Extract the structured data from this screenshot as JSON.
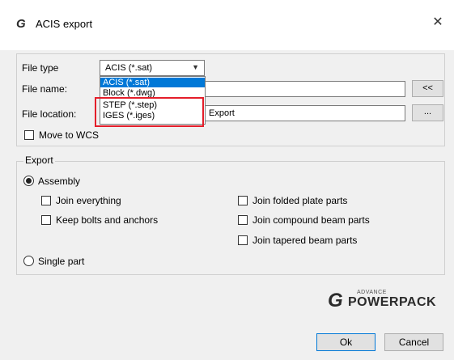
{
  "window": {
    "title": "ACIS export",
    "logo_glyph": "G",
    "close_glyph": "✕"
  },
  "file_type": {
    "label": "File type",
    "selected": "ACIS (*.sat)",
    "options": [
      "ACIS (*.sat)",
      "Block (*.dwg)",
      "STEP (*.step)",
      "IGES (*.iges)"
    ]
  },
  "file_name": {
    "label": "File name:",
    "value": "",
    "button": "<<"
  },
  "file_location": {
    "label": "File location:",
    "value": "Export",
    "button": "..."
  },
  "move_to_wcs": {
    "label": "Move to WCS",
    "checked": false
  },
  "export": {
    "group_label": "Export",
    "assembly": {
      "label": "Assembly",
      "selected": true
    },
    "options_left": [
      "Join everything",
      "Keep bolts and anchors"
    ],
    "options_right": [
      "Join folded plate parts",
      "Join compound beam parts",
      "Join tapered beam parts"
    ],
    "single_part": {
      "label": "Single part",
      "selected": false
    }
  },
  "brand": {
    "glyph": "G",
    "advance": "ADVANCE",
    "name": "POWERPACK"
  },
  "buttons": {
    "ok": "Ok",
    "cancel": "Cancel"
  },
  "colors": {
    "highlight": "#e41e2a",
    "selection": "#0078d7"
  }
}
